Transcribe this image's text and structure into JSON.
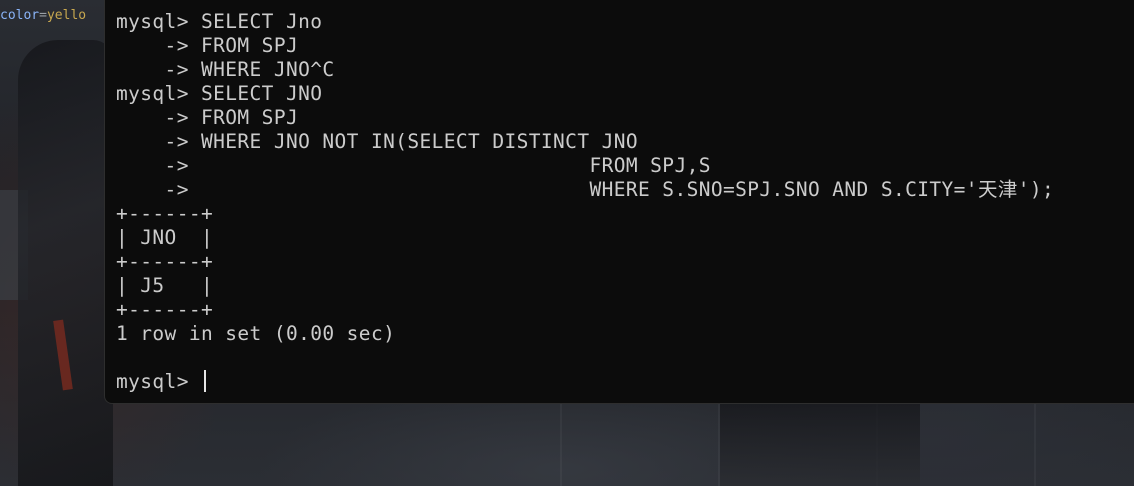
{
  "editor_snippet": {
    "key": "color",
    "separator": "=",
    "value": "yello"
  },
  "terminal": {
    "lines": [
      "mysql> SELECT Jno",
      "    -> FROM SPJ",
      "    -> WHERE JNO^C",
      "mysql> SELECT JNO",
      "    -> FROM SPJ",
      "    -> WHERE JNO NOT IN(SELECT DISTINCT JNO",
      "    ->                                 FROM SPJ,S",
      "    ->                                 WHERE S.SNO=SPJ.SNO AND S.CITY='天津');",
      "+------+",
      "| JNO  |",
      "+------+",
      "| J5   |",
      "+------+",
      "1 row in set (0.00 sec)",
      ""
    ],
    "prompt": "mysql> "
  }
}
